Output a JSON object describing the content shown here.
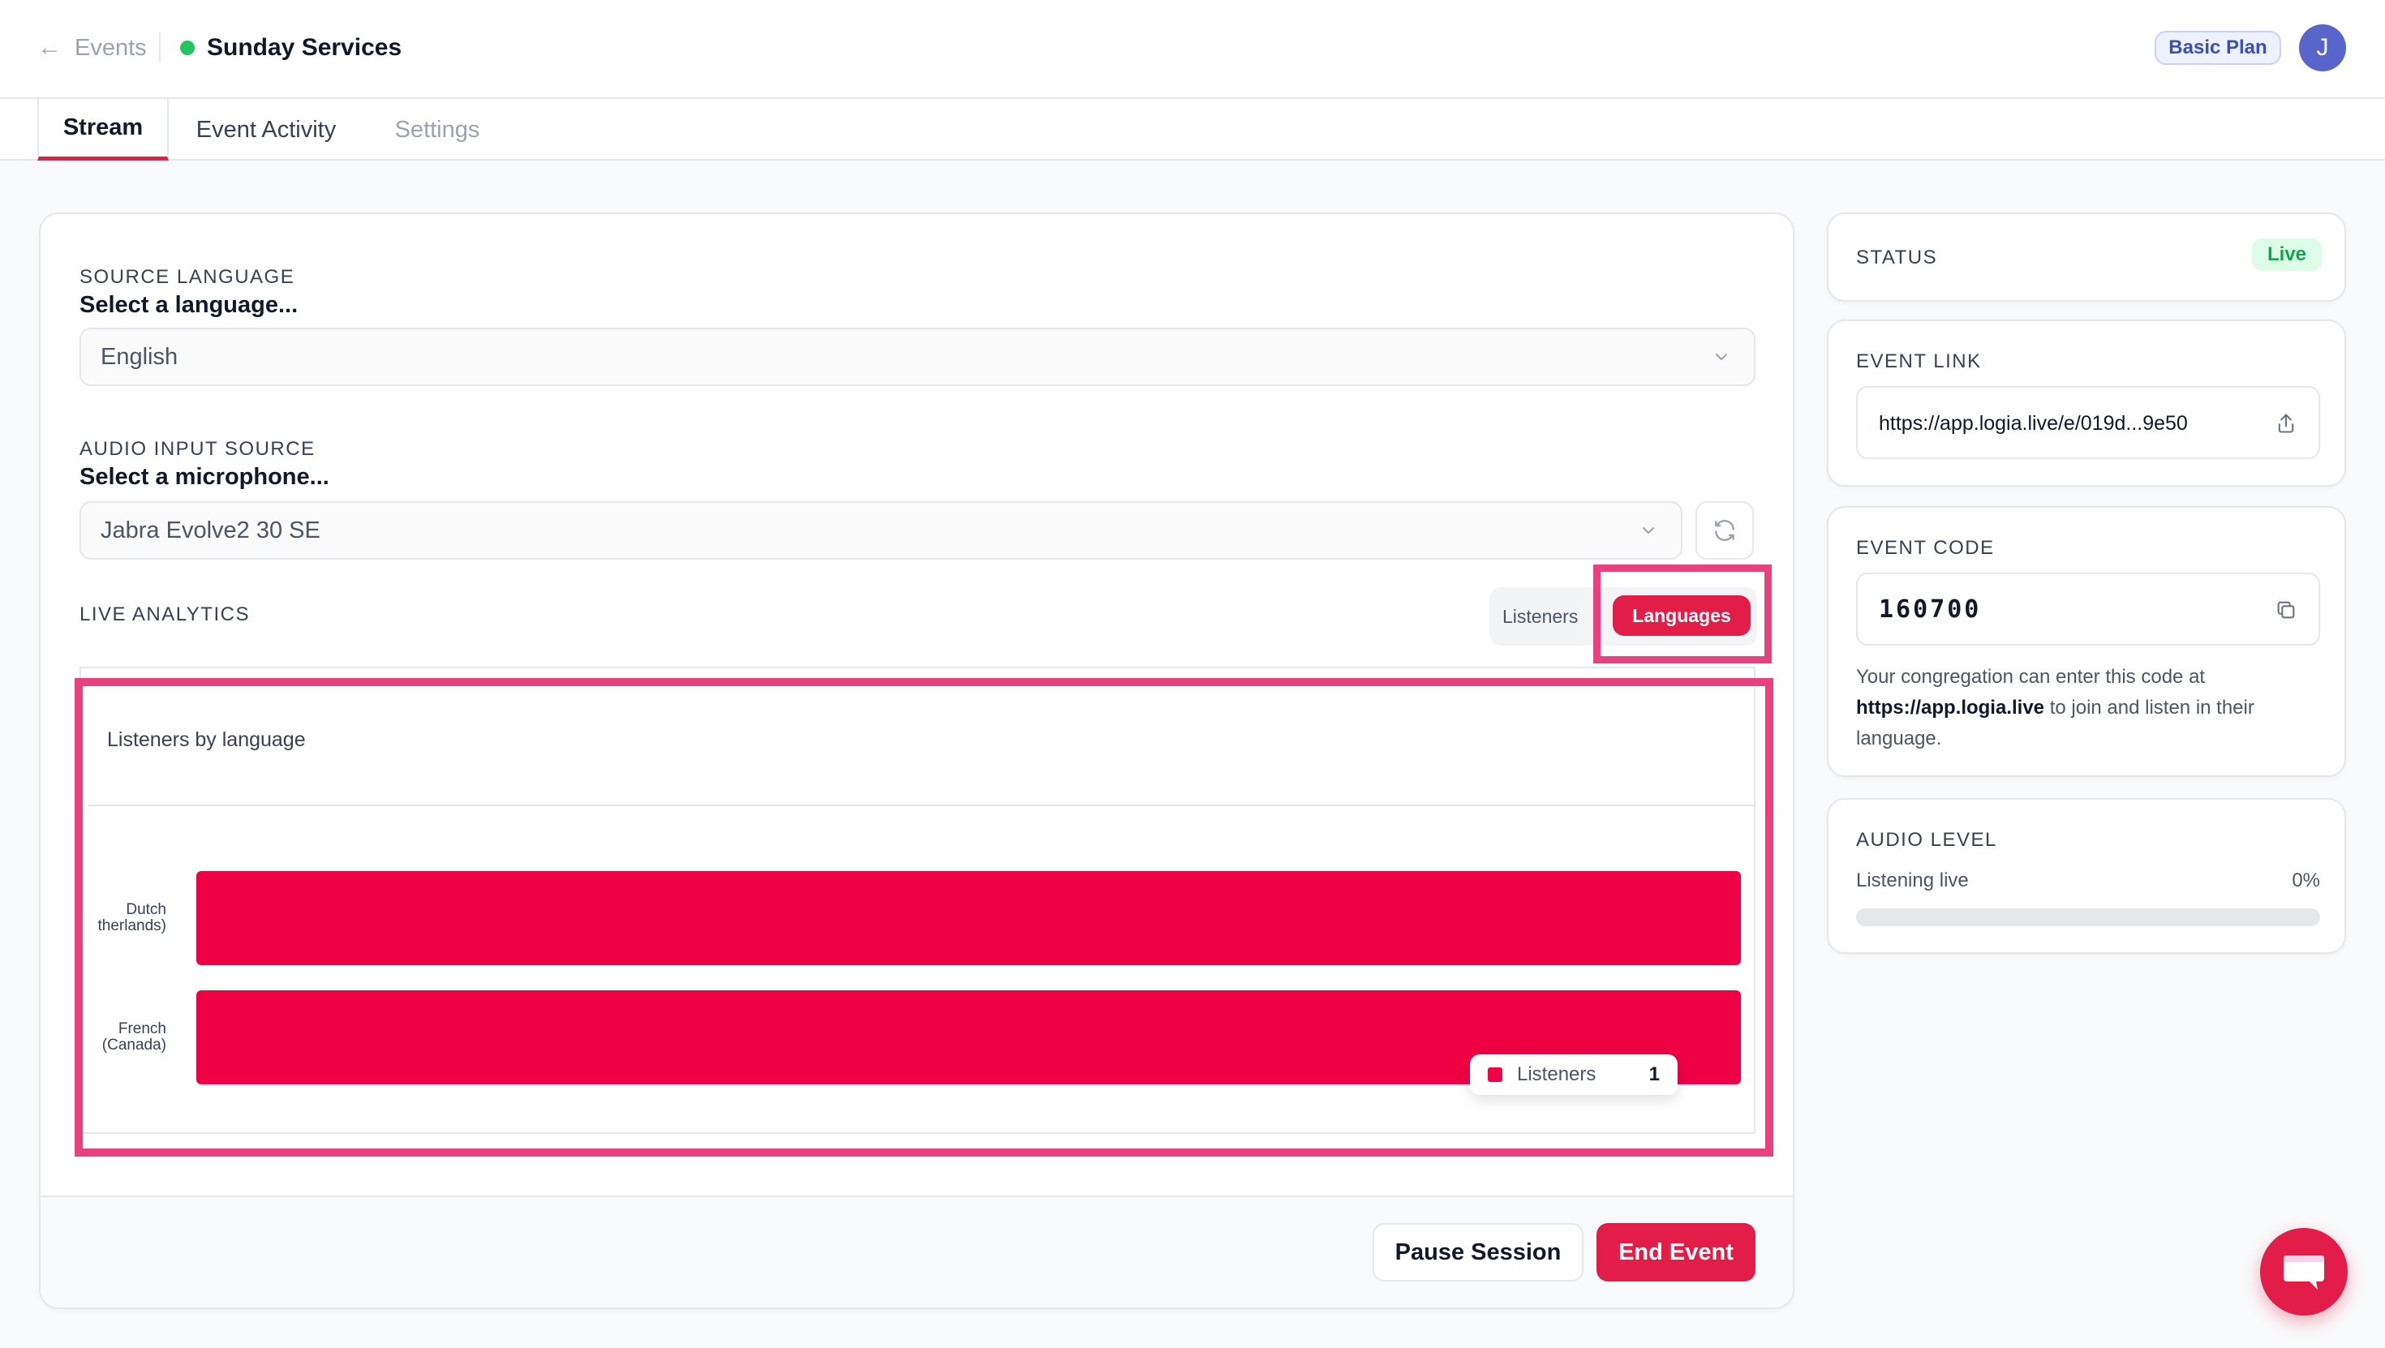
{
  "header": {
    "back_label": "Events",
    "event_title": "Sunday Services",
    "plan_badge": "Basic Plan",
    "avatar_initial": "J"
  },
  "tabs": [
    {
      "label": "Stream",
      "active": true
    },
    {
      "label": "Event Activity",
      "active": false
    },
    {
      "label": "Settings",
      "active": false
    }
  ],
  "source_language": {
    "label": "SOURCE LANGUAGE",
    "prompt": "Select a language...",
    "value": "English"
  },
  "audio_input": {
    "label": "AUDIO INPUT SOURCE",
    "prompt": "Select a microphone...",
    "value": "Jabra Evolve2 30 SE"
  },
  "analytics": {
    "label": "LIVE ANALYTICS",
    "toggle_listeners": "Listeners",
    "toggle_languages": "Languages",
    "selected": "Languages"
  },
  "chart_data": {
    "type": "bar",
    "orientation": "horizontal",
    "title": "Listeners by language",
    "categories": [
      "Dutch (Netherlands)",
      "French (Canada)"
    ],
    "category_labels_visible": [
      [
        "Dutch",
        "therlands)"
      ],
      [
        "French",
        "(Canada)"
      ]
    ],
    "series": [
      {
        "name": "Listeners",
        "values": [
          1,
          1
        ]
      }
    ],
    "xlim": [
      0,
      1
    ],
    "grid": false,
    "color": "#ef0044",
    "tooltip": {
      "series": "Listeners",
      "value": "1"
    }
  },
  "actions": {
    "pause_label": "Pause Session",
    "end_label": "End Event"
  },
  "status": {
    "label": "STATUS",
    "value": "Live"
  },
  "event_link": {
    "label": "EVENT LINK",
    "value": "https://app.logia.live/e/019d...9e50"
  },
  "event_code": {
    "label": "EVENT CODE",
    "value": "160700",
    "help_prefix": "Your congregation can enter this code at",
    "help_link": "https://app.logia.live",
    "help_suffix": "to join and listen in their language."
  },
  "audio_level": {
    "label": "AUDIO LEVEL",
    "status": "Listening live",
    "percent_label": "0%",
    "level": 0
  },
  "colors": {
    "accent": "#e11d48",
    "bar": "#ef0044",
    "live": "#22c55e",
    "highlight": "#e8417e"
  }
}
